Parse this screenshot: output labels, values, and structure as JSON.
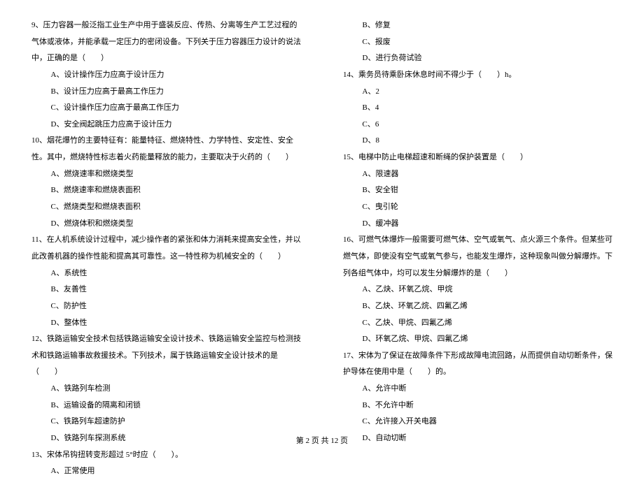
{
  "q9": {
    "text": "9、压力容器一般泛指工业生产中用于盛装反应、传热、分离等生产工艺过程的气体或液体，并能承载一定压力的密闭设备。下列关于压力容器压力设计的说法中，正确的是（　　）",
    "optA": "A、设计操作压力应高于设计压力",
    "optB": "B、设计压力应高于最高工作压力",
    "optC": "C、设计操作压力应高于最高工作压力",
    "optD": "D、安全阀起跳压力应高于设计压力"
  },
  "q10": {
    "text": "10、烟花爆竹的主要特征有：能量特征、燃烧特性、力学特性、安定性、安全性。其中，燃烧特性标志着火药能量释放的能力，主要取决于火药的（　　）",
    "optA": "A、燃烧速率和燃烧类型",
    "optB": "B、燃烧速率和燃烧表面积",
    "optC": "C、燃烧类型和燃烧表面积",
    "optD": "D、燃烧体积和燃烧类型"
  },
  "q11": {
    "text": "11、在人机系统设计过程中，减少操作者的紧张和体力消耗来提高安全性，并以此改善机器的操作性能和提高其可靠性。这一特性称为机械安全的（　　）",
    "optA": "A、系统性",
    "optB": "B、友善性",
    "optC": "C、防护性",
    "optD": "D、整体性"
  },
  "q12": {
    "text": "12、铁路运输安全技术包括铁路运输安全设计技术、铁路运输安全监控与检测技术和铁路运输事故救援技术。下列技术，属于铁路运输安全设计技术的是（　　）",
    "optA": "A、铁路列车检测",
    "optB": "B、运输设备的隔离和闭锁",
    "optC": "C、铁路列车超速防护",
    "optD": "D、铁路列车探测系统"
  },
  "q13": {
    "text": "13、宋体吊钩扭转变形超过 5°时应（　　）。",
    "optA": "A、正常使用",
    "optB": "B、修复",
    "optC": "C、报废",
    "optD": "D、进行负荷试验"
  },
  "q14": {
    "text": "14、乘务员待乘卧床休息时间不得少于（　　）h。",
    "optA": "A、2",
    "optB": "B、4",
    "optC": "C、6",
    "optD": "D、8"
  },
  "q15": {
    "text": "15、电梯中防止电梯超速和断绳的保护装置是（　　）",
    "optA": "A、限速器",
    "optB": "B、安全钳",
    "optC": "C、曳引轮",
    "optD": "D、缓冲器"
  },
  "q16": {
    "text": "16、可燃气体爆炸一般需要可燃气体、空气或氧气、点火源三个条件。但某些可燃气体，即使没有空气或氧气参与，也能发生爆炸，这种现象叫做分解爆炸。下列各组气体中，均可以发生分解爆炸的是（　　）",
    "optA": "A、乙炔、环氧乙烷、甲烷",
    "optB": "B、乙炔、环氧乙烷、四氟乙烯",
    "optC": "C、乙炔、甲烷、四氟乙烯",
    "optD": "D、环氧乙烷、甲烷、四氟乙烯"
  },
  "q17": {
    "text": "17、宋体为了保证在故障条件下形成故障电流回路，从而提供自动切断条件，保护导体在使用中是（　　）的。",
    "optA": "A、允许中断",
    "optB": "B、不允许中断",
    "optC": "C、允许接入开关电器",
    "optD": "D、自动切断"
  },
  "footer": "第 2 页 共 12 页"
}
